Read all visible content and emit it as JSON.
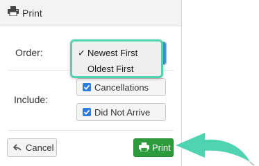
{
  "dialog": {
    "title": "Print",
    "icons": {
      "title": "printer-icon",
      "cancel": "back-arrow-icon",
      "print": "printer-icon"
    }
  },
  "order": {
    "label": "Order:",
    "options": [
      "Newest First",
      "Oldest First"
    ],
    "selected": "Newest First",
    "check_mark": "✓"
  },
  "include": {
    "label": "Include:",
    "options": [
      {
        "label": "Cancellations",
        "checked": true
      },
      {
        "label": "Did Not Arrive",
        "checked": true
      }
    ]
  },
  "buttons": {
    "cancel": "Cancel",
    "print": "Print"
  },
  "colors": {
    "highlight": "#4fd3b0",
    "print_button": "#2d9b3c",
    "checkbox": "#2e7be0",
    "select_accent": "#3c97d6"
  }
}
